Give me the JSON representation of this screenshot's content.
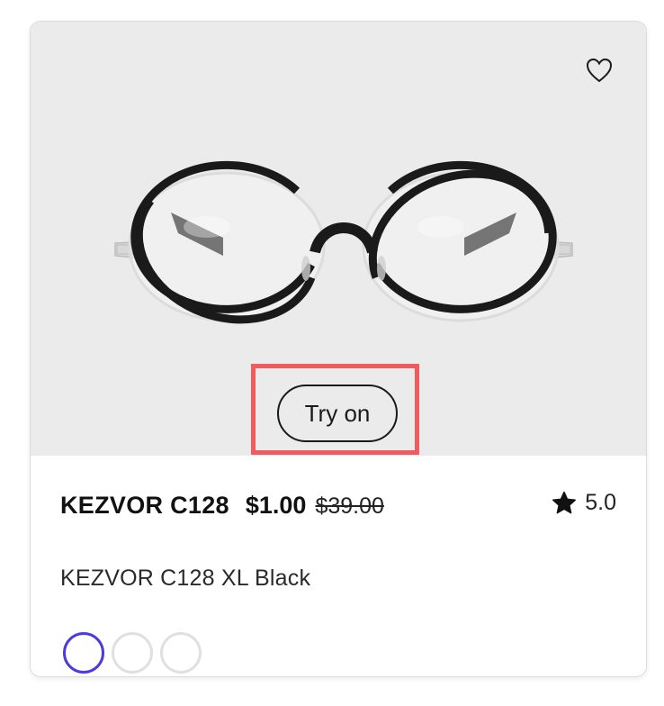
{
  "product": {
    "name": "KEZVOR C128",
    "price": "$1.00",
    "original_price": "$39.00",
    "rating": "5.0",
    "variant": "KEZVOR C128 XL Black",
    "try_on_label": "Try on",
    "wishlist_icon": "heart-outline-icon",
    "rating_icon": "star-icon"
  },
  "swatches": [
    {
      "selected": true
    },
    {
      "selected": false
    },
    {
      "selected": false
    }
  ],
  "colors": {
    "media_background": "#ebebeb",
    "highlight": "#f15b5b",
    "selected_swatch": "#4a3be0",
    "frame": "#1a1a1a"
  }
}
